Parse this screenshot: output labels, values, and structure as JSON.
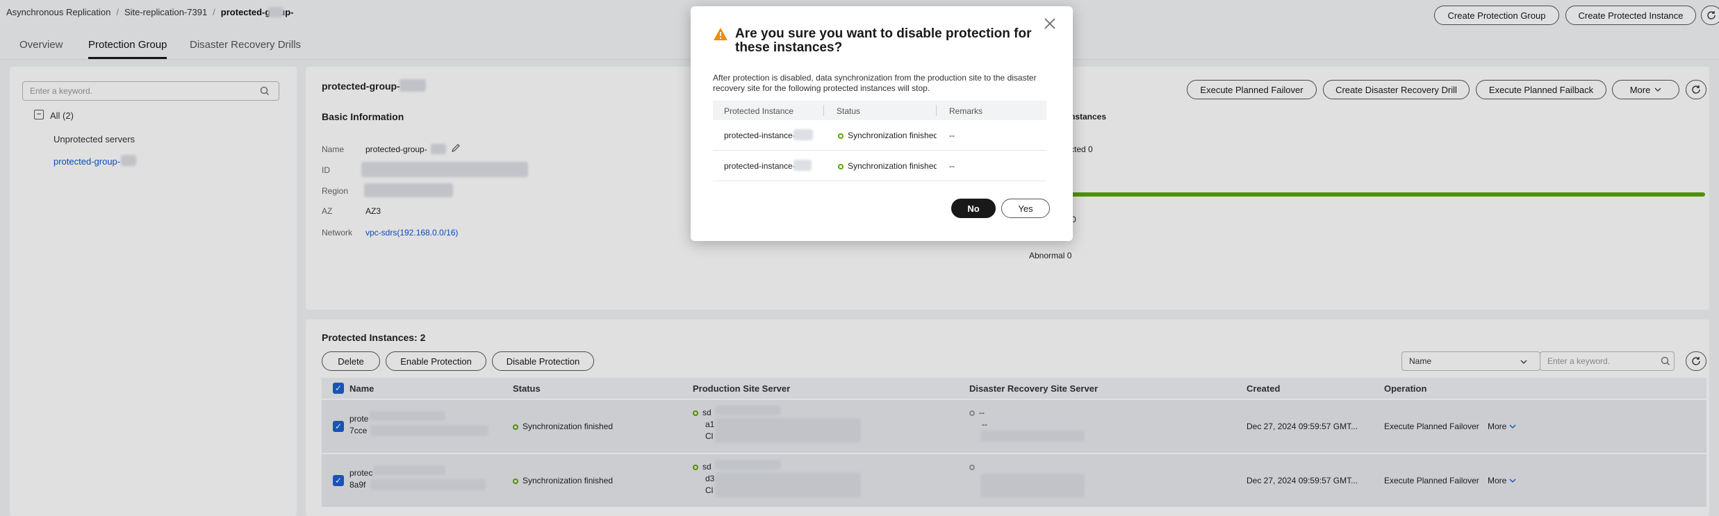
{
  "breadcrumb": {
    "items": [
      "Asynchronous Replication",
      "Site-replication-7391",
      "protected-group-"
    ],
    "separator": "/"
  },
  "header_actions": {
    "create_protection_group": "Create Protection Group",
    "create_protected_instance": "Create Protected Instance"
  },
  "tabs": [
    {
      "label": "Overview"
    },
    {
      "label": "Protection Group"
    },
    {
      "label": "Disaster Recovery Drills"
    }
  ],
  "sidebar": {
    "search_placeholder": "Enter a keyword.",
    "all_label": "All (2)",
    "items": [
      {
        "label": "Unprotected servers"
      },
      {
        "label": "protected-group-"
      }
    ]
  },
  "group": {
    "title": "protected-group-",
    "actions": {
      "failover": "Execute Planned Failover",
      "drill": "Create Disaster Recovery Drill",
      "failback": "Execute Planned Failback",
      "more": "More"
    },
    "basic_info_heading": "Basic Information",
    "fields": {
      "name_label": "Name",
      "name_value": "protected-group-",
      "id_label": "ID",
      "region_label": "Region",
      "az_label": "AZ",
      "az_value": "AZ3",
      "network_label": "Network",
      "network_value": "vpc-sdrs(192.168.0.0/16)"
    },
    "instances_summary": {
      "heading": "nstances",
      "protected": "cted 0",
      "zero": "0",
      "abnormal": "Abnormal 0"
    }
  },
  "instances": {
    "heading": "Protected Instances: 2",
    "actions": {
      "delete": "Delete",
      "enable": "Enable Protection",
      "disable": "Disable Protection"
    },
    "filter": {
      "select_value": "Name",
      "search_placeholder": "Enter a keyword."
    },
    "columns": [
      "Name",
      "Status",
      "Production Site Server",
      "Disaster Recovery Site Server",
      "Created",
      "Operation"
    ],
    "rows": [
      {
        "name": "prote",
        "id_prefix": "7cce",
        "status": "Synchronization finished",
        "prod_name": "sd",
        "prod_l2": "a1",
        "prod_l3": "Cl",
        "dr_l1": "--",
        "dr_l2": "--",
        "created": "Dec 27, 2024 09:59:57 GMT...",
        "op": "Execute Planned Failover",
        "more": "More"
      },
      {
        "name": "protec",
        "id_prefix": "8a9f",
        "status": "Synchronization finished",
        "prod_name": "sd",
        "prod_l2": "d3",
        "prod_l3": "Cl",
        "dr_l1": "",
        "dr_l2": "",
        "created": "Dec 27, 2024 09:59:57 GMT...",
        "op": "Execute Planned Failover",
        "more": "More"
      }
    ]
  },
  "modal": {
    "title": "Are you sure you want to disable protection for these instances?",
    "message": "After protection is disabled, data synchronization from the production site to the disaster recovery site for the following protected instances will stop.",
    "columns": [
      "Protected Instance",
      "Status",
      "Remarks"
    ],
    "rows": [
      {
        "instance": "protected-instance-",
        "status": "Synchronization finished",
        "remarks": "--"
      },
      {
        "instance": "protected-instance-",
        "status": "Synchronization finished",
        "remarks": "--"
      }
    ],
    "no": "No",
    "yes": "Yes"
  },
  "colors": {
    "accent": "#0a56d6",
    "success": "#5aa700",
    "warning": "#f08c00",
    "dark": "#191919"
  }
}
